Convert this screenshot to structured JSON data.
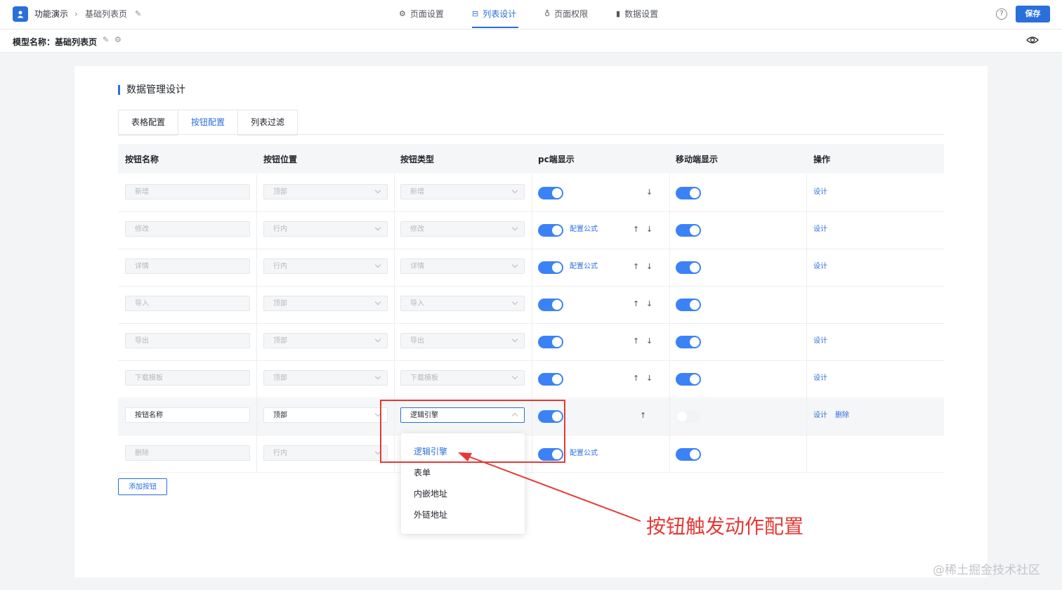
{
  "header": {
    "app": "功能演示",
    "page": "基础列表页",
    "nav": [
      "页面设置",
      "列表设计",
      "页面权限",
      "数据设置"
    ],
    "active_nav": "列表设计",
    "help": "?",
    "save": "保存"
  },
  "subheader": {
    "model_label": "模型名称：基础列表页"
  },
  "section": {
    "title": "数据管理设计",
    "tabs": [
      "表格配置",
      "按钮配置",
      "列表过滤"
    ],
    "active_tab": "按钮配置"
  },
  "table": {
    "headers": [
      "按钮名称",
      "按钮位置",
      "按钮类型",
      "pc端显示",
      "移动端显示",
      "操作"
    ],
    "rows": [
      {
        "name": "新增",
        "position": "顶部",
        "type": "新增",
        "formula": "",
        "up": "",
        "down": "↓",
        "actions": [
          "设计"
        ]
      },
      {
        "name": "修改",
        "position": "行内",
        "type": "修改",
        "formula": "配置公式",
        "up": "↑",
        "down": "↓",
        "actions": [
          "设计"
        ]
      },
      {
        "name": "详情",
        "position": "行内",
        "type": "详情",
        "formula": "配置公式",
        "up": "↑",
        "down": "↓",
        "actions": [
          "设计"
        ]
      },
      {
        "name": "导入",
        "position": "顶部",
        "type": "导入",
        "formula": "",
        "up": "↑",
        "down": "↓",
        "actions": []
      },
      {
        "name": "导出",
        "position": "顶部",
        "type": "导出",
        "formula": "",
        "up": "↑",
        "down": "↓",
        "actions": [
          "设计"
        ]
      },
      {
        "name": "下载模板",
        "position": "顶部",
        "type": "下载模板",
        "formula": "",
        "up": "↑",
        "down": "↓",
        "actions": [
          "设计"
        ]
      },
      {
        "name": "按钮名称",
        "position": "顶部",
        "type": "逻辑引擎",
        "formula": "",
        "up": "↑",
        "down": "",
        "actions": [
          "设计",
          "删除"
        ]
      },
      {
        "name": "删除",
        "position": "行内",
        "type": "",
        "formula": "配置公式",
        "up": "",
        "down": "",
        "actions": []
      }
    ],
    "add_button": "添加按钮"
  },
  "dropdown": {
    "options": [
      "逻辑引擎",
      "表单",
      "内嵌地址",
      "外链地址"
    ],
    "selected": "逻辑引擎"
  },
  "annotation": "按钮触发动作配置",
  "watermark": "@稀土掘金技术社区",
  "colors": {
    "primary": "#2a6fdb",
    "toggle": "#3b82f6",
    "annotation": "#e53935"
  }
}
